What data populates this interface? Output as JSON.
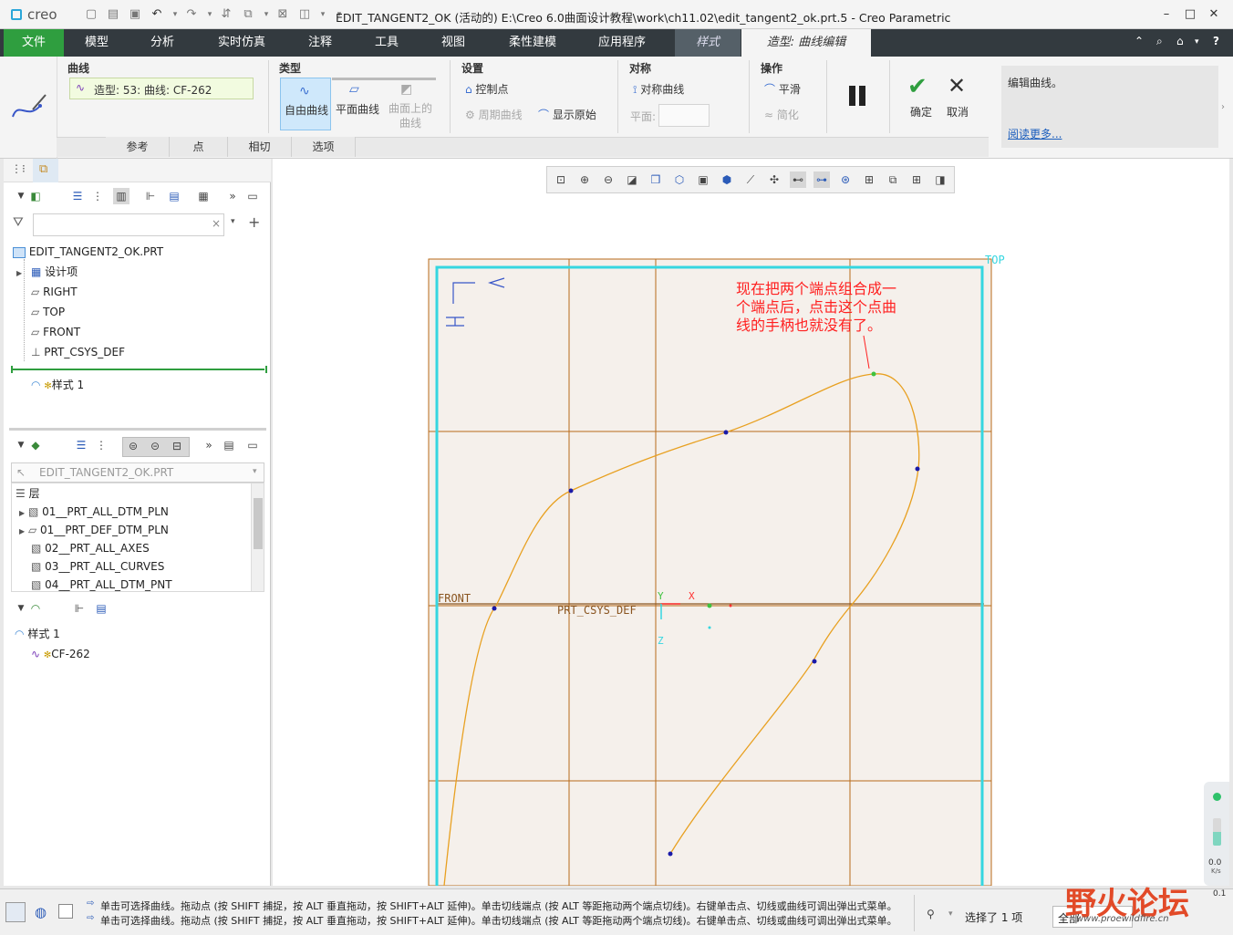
{
  "colors": {
    "accent": "#2f9e3f",
    "menubar": "#333a3f",
    "curve": "#e8a020",
    "grid": "#b86a1a",
    "frame": "#35d6e0",
    "annotation": "#ff2020"
  },
  "titlebar": {
    "logo": "creo",
    "title": "EDIT_TANGENT2_OK (活动的) E:\\Creo 6.0曲面设计教程\\work\\ch11.02\\edit_tangent2_ok.prt.5 - Creo Parametric",
    "buttons": [
      "–",
      "□",
      "✕"
    ]
  },
  "menubar": {
    "file": "文件",
    "items": [
      "模型",
      "分析",
      "实时仿真",
      "注释",
      "工具",
      "视图",
      "柔性建模",
      "应用程序"
    ],
    "style_tab": "样式",
    "curve_edit_tab": "造型: 曲线编辑"
  },
  "ribbon": {
    "curve_group": {
      "label": "曲线",
      "field": "造型: 53: 曲线: CF-262"
    },
    "type_group": {
      "label": "类型",
      "freeform": "自由曲线",
      "planar": "平面曲线",
      "on_surface": "曲面上的曲线"
    },
    "settings_group": {
      "label": "设置",
      "control_points": "控制点",
      "periodic": "周期曲线",
      "show_original": "显示原始"
    },
    "symmetry_group": {
      "label": "对称",
      "symmetric": "对称曲线",
      "plane_label": "平面:"
    },
    "operation_group": {
      "label": "操作",
      "smooth": "平滑",
      "simplify": "简化"
    },
    "ok": "确定",
    "cancel": "取消",
    "help_text": "编辑曲线。",
    "read_more": "阅读更多...",
    "subtabs": [
      "参考",
      "点",
      "相切",
      "选项"
    ]
  },
  "model_tree": {
    "search_placeholder": "",
    "root": "EDIT_TANGENT2_OK.PRT",
    "items": [
      "设计项",
      "RIGHT",
      "TOP",
      "FRONT",
      "PRT_CSYS_DEF"
    ],
    "insert_item": "样式 1"
  },
  "layer_tree": {
    "model": "EDIT_TANGENT2_OK.PRT",
    "header": "层",
    "layers": [
      "01__PRT_ALL_DTM_PLN",
      "01__PRT_DEF_DTM_PLN",
      "02__PRT_ALL_AXES",
      "03__PRT_ALL_CURVES",
      "04__PRT_ALL_DTM_PNT"
    ]
  },
  "style_tree": {
    "root": "样式 1",
    "child": "CF-262"
  },
  "viewport": {
    "label_top": "TOP",
    "label_front": "FRONT",
    "csys_label": "PRT_CSYS_DEF",
    "axis_x": "X",
    "axis_y": "Y",
    "axis_z": "Z",
    "annotation": [
      "现在把两个端点组合成一",
      "个端点后，点击这个点曲",
      "线的手柄也就没有了。"
    ]
  },
  "statusbar": {
    "messages": [
      "单击可选择曲线。拖动点 (按 SHIFT 捕捉，按 ALT 垂直拖动，按 SHIFT+ALT 延伸)。单击切线端点 (按 ALT 等距拖动两个端点切线)。右键单击点、切线或曲线可调出弹出式菜单。",
      "单击可选择曲线。拖动点 (按 SHIFT 捕捉，按 ALT 垂直拖动，按 SHIFT+ALT 延伸)。单击切线端点 (按 ALT 等距拖动两个端点切线)。右键单击点、切线或曲线可调出弹出式菜单。"
    ],
    "selected": "选择了 1 项",
    "filter": "全部",
    "watermark": "野火论坛",
    "watermark_url": "www.proewildfire.cn",
    "net_up": "0.0",
    "net_down": "0.1",
    "net_unit": "K/s"
  }
}
